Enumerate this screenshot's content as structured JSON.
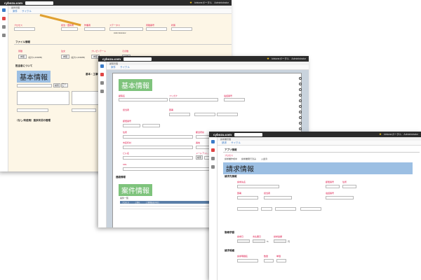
{
  "app": {
    "logo": "cybozu.com",
    "user": "Administrator",
    "portal_link": "kintoneポータル"
  },
  "shot1": {
    "crumb": "案件管理",
    "tabs": [
      "案件",
      "サイクル"
    ],
    "labels": [
      "プロセス",
      "担当・更新者",
      "作業者",
      "ステータス",
      "見積番号",
      "状態"
    ],
    "file_section": "ファイル情報",
    "file_fields": [
      "見積",
      "注文",
      "プレゼンテート",
      "その他"
    ],
    "file_button": "参照",
    "file_note": "(最大1,000MB)",
    "memo_section": "担当者について",
    "heading": "基本情報",
    "subhead": "基本・工事情報（入力）",
    "search_button": "検索",
    "clear_button": "クリア",
    "assignee": "Administrator",
    "bottom_section": "（なし/未使用）進捗状況の管理"
  },
  "shot2": {
    "crumb": "顧客管理",
    "tabs": [
      "案件",
      "サイクル"
    ],
    "heading": "基本情報",
    "labels": [
      "顧客名",
      "フリガナ",
      "電話番号",
      "担当者",
      "部署",
      "郵便番号",
      "住所",
      "都道府県",
      "市区町村",
      "番地",
      "ビル名",
      "メールアドレス",
      "URL",
      "業種"
    ],
    "search_button": "検索",
    "section_small": "連絡情報",
    "heading2": "案件情報",
    "list_label": "案件一覧",
    "grid_header": [
      "プロセス",
      "工事名",
      "工事開始日(予定)"
    ]
  },
  "shot3": {
    "crumb": "請求書管理",
    "tabs": [
      "請求",
      "サイクル"
    ],
    "app_section": "アプリ情報",
    "process_label": "プロセス",
    "process_options": [
      "請求書作成中",
      "請求書発行済み",
      "入金済"
    ],
    "heading": "請求情報",
    "sub1": "請求先情報",
    "labels": [
      "請求先名",
      "郵便番号",
      "住所",
      "部署",
      "担当者",
      "電話番号",
      "請求日",
      "支払期日",
      "請求金額"
    ],
    "sub2": "御請求額",
    "sub3": "請求明細",
    "items": [
      "請求明細名",
      "数量",
      "単価"
    ],
    "percent": "%",
    "yen": "円"
  }
}
